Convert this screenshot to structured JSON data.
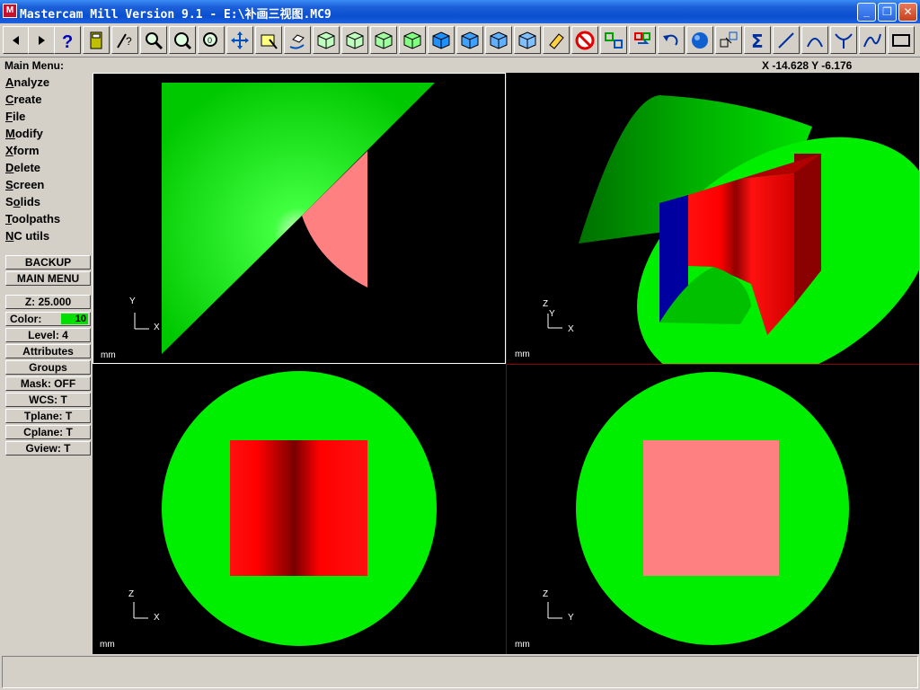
{
  "window": {
    "title": "Mastercam Mill Version 9.1 - E:\\补画三视图.MC9",
    "icon_label": "M",
    "minimize": "_",
    "maximize": "❐",
    "close": "✕"
  },
  "header": {
    "main_menu_label": "Main Menu:",
    "coordinates": "X -14.628  Y -6.176"
  },
  "menu": {
    "items": [
      {
        "first": "A",
        "rest": "nalyze"
      },
      {
        "first": "C",
        "rest": "reate"
      },
      {
        "first": "F",
        "rest": "ile"
      },
      {
        "first": "M",
        "rest": "odify"
      },
      {
        "first": "X",
        "rest": "form"
      },
      {
        "first": "D",
        "rest": "elete"
      },
      {
        "first": "S",
        "rest": "creen"
      },
      {
        "first": "S",
        "rest": "olids",
        "underline_index": 1
      },
      {
        "first": "T",
        "rest": "oolpaths"
      },
      {
        "first": "N",
        "rest": "C utils"
      }
    ],
    "backup": "BACKUP",
    "main_menu": "MAIN MENU"
  },
  "settings": {
    "z": "Z:  25.000",
    "color_label": "Color:",
    "color_value": "10",
    "level": "Level:  4",
    "attributes": "Attributes",
    "groups": "Groups",
    "mask": "Mask:  OFF",
    "wcs": "WCS:   T",
    "tplane": "Tplane:  T",
    "cplane": "Cplane:  T",
    "gview": "Gview:   T"
  },
  "viewports": {
    "unit": "mm",
    "top_left": {
      "axis_v": "Y",
      "axis_h": "X"
    },
    "top_right": {
      "axis_v": "Z",
      "axis_v2": "Y",
      "axis_h": "X"
    },
    "bottom_left": {
      "axis_v": "Z",
      "axis_h": "X"
    },
    "bottom_right": {
      "axis_v": "Z",
      "axis_h": "Y"
    }
  },
  "colors": {
    "green": "#00ee00",
    "red": "#ff0000",
    "pink": "#ff8080",
    "blue": "#0000a0",
    "divider": "#8b0000"
  },
  "toolbar_icons": [
    "back-icon",
    "forward-icon",
    "help-icon",
    "calculator-icon",
    "analyze-icon",
    "zoom-window-icon",
    "unzoom-icon",
    "zoom-fit-icon",
    "pan-icon",
    "select-icon",
    "rotate-view-icon",
    "cube-top-icon",
    "cube-front-icon",
    "cube-side-icon",
    "cube-iso-icon",
    "cube-solid-icon",
    "cube-solid-2-icon",
    "cube-solid-3-icon",
    "cube-solid-4-icon",
    "eraser-icon",
    "no-icon",
    "mirror-icon",
    "transform-icon",
    "undo-icon",
    "sphere-icon",
    "group-icon",
    "sum-icon",
    "line-icon",
    "arc-icon",
    "fillet-icon",
    "spline-icon",
    "rectangle-icon"
  ]
}
